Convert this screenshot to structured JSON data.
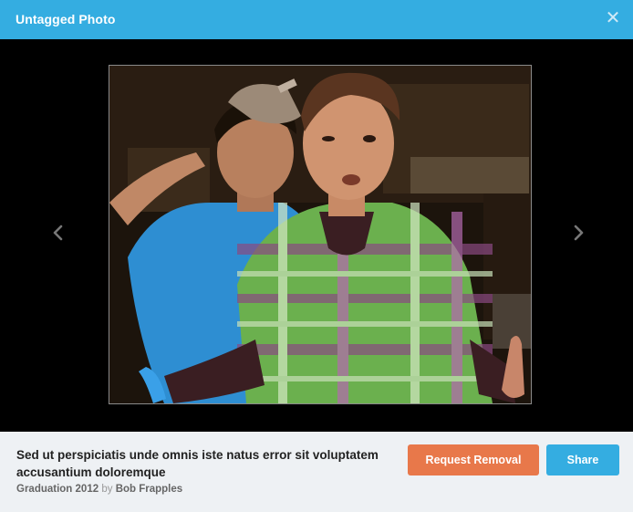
{
  "header": {
    "title": "Untagged Photo",
    "close_icon": "close-icon"
  },
  "viewer": {
    "prev_icon": "chevron-left-icon",
    "next_icon": "chevron-right-icon"
  },
  "footer": {
    "caption": "Sed ut perspiciatis unde omnis iste natus error sit voluptatem accusantium doloremque",
    "album": "Graduation 2012",
    "by": "by",
    "author": "Bob Frapples",
    "request_removal_label": "Request Removal",
    "share_label": "Share"
  },
  "colors": {
    "header_bg": "#34ade1",
    "removal_button": "#e8784a",
    "share_button": "#34ade1",
    "footer_bg": "#eef1f4"
  }
}
